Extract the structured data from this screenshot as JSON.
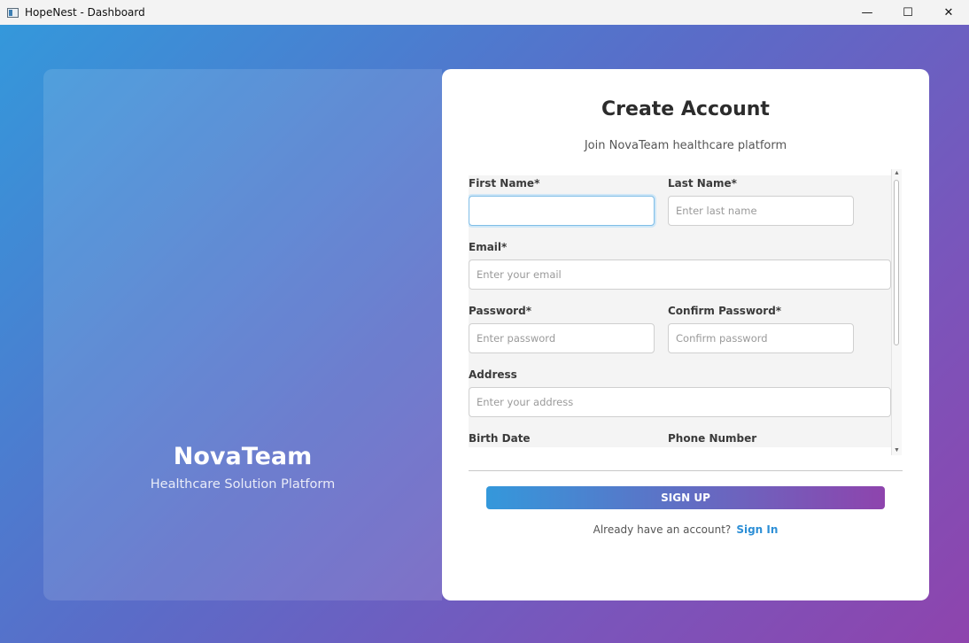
{
  "window": {
    "title": "HopeNest - Dashboard",
    "controls": {
      "minimize": "—",
      "maximize": "☐",
      "close": "✕"
    }
  },
  "brand": {
    "name": "NovaTeam",
    "tagline": "Healthcare Solution Platform"
  },
  "form": {
    "title": "Create Account",
    "subtitle": "Join NovaTeam healthcare platform",
    "fields": {
      "first_name": {
        "label": "First Name*",
        "value": "",
        "placeholder": ""
      },
      "last_name": {
        "label": "Last Name*",
        "value": "",
        "placeholder": "Enter last name"
      },
      "email": {
        "label": "Email*",
        "value": "",
        "placeholder": "Enter your email"
      },
      "password": {
        "label": "Password*",
        "value": "",
        "placeholder": "Enter password"
      },
      "confirm_password": {
        "label": "Confirm Password*",
        "value": "",
        "placeholder": "Confirm password"
      },
      "address": {
        "label": "Address",
        "value": "",
        "placeholder": "Enter your address"
      },
      "birth_date": {
        "label": "Birth Date"
      },
      "phone_number": {
        "label": "Phone Number"
      }
    },
    "submit_label": "SIGN UP",
    "signin_prompt": "Already have an account?",
    "signin_link": "Sign In"
  },
  "colors": {
    "gradient_start": "#3498db",
    "gradient_end": "#8e44ad",
    "link": "#2d8fd6"
  }
}
